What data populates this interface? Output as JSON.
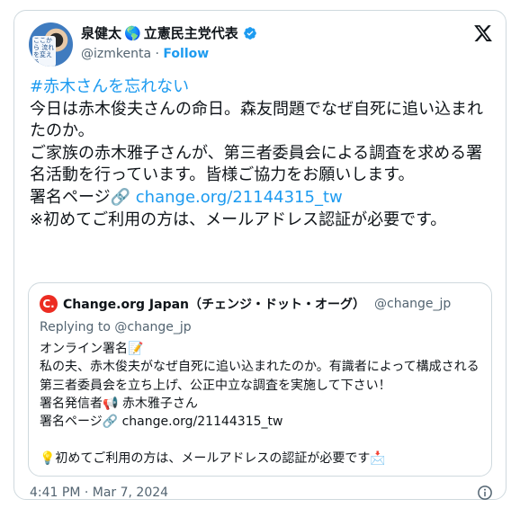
{
  "author": {
    "name": "泉健太",
    "globe_emoji": "🌎",
    "party": "立憲民主党代表",
    "handle": "@izmkenta",
    "separator": "·",
    "follow_label": "Follow",
    "avatar_text": "ここから 流れを変える",
    "verified_color": "#1d9bf0"
  },
  "post": {
    "hashtag": "#赤木さんを忘れない",
    "text_main": "今日は赤木俊夫さんの命日。森友問題でなぜ自死に追い込まれたのか。\nご家族の赤木雅子さんが、第三者委員会による調査を求める署名活動を行っています。皆様ご協力をお願いします。\n署名ページ🔗 ",
    "link": "change.org/21144315_tw",
    "text_tail": "\n※初めてご利用の方は、メールアドレス認証が必要です。"
  },
  "quoted": {
    "logo_letter": "C.",
    "name": "Change.org Japan（チェンジ・ドット・オーグ）",
    "handle": "@change_jp",
    "replying": "Replying to @change_jp",
    "text": "オンライン署名📝\n私の夫、赤木俊夫がなぜ自死に追い込まれたのか。有識者によって構成される第三者委員会を立ち上げ、公正中立な調査を実施して下さい！\n署名発信者📢 赤木雅子さん\n署名ページ🔗 change.org/21144315_tw\n\n💡初めてご利用の方は、メールアドレスの認証が必要です📩"
  },
  "footer": {
    "timestamp": "4:41 PM · Mar 7, 2024"
  },
  "icons": {
    "verified": "verified-badge-icon",
    "x_logo": "x-logo-icon",
    "info": "info-icon"
  },
  "colors": {
    "accent": "#1d9bf0",
    "border": "#cfd9de",
    "muted": "#536471",
    "change_red": "#ec2c22"
  }
}
